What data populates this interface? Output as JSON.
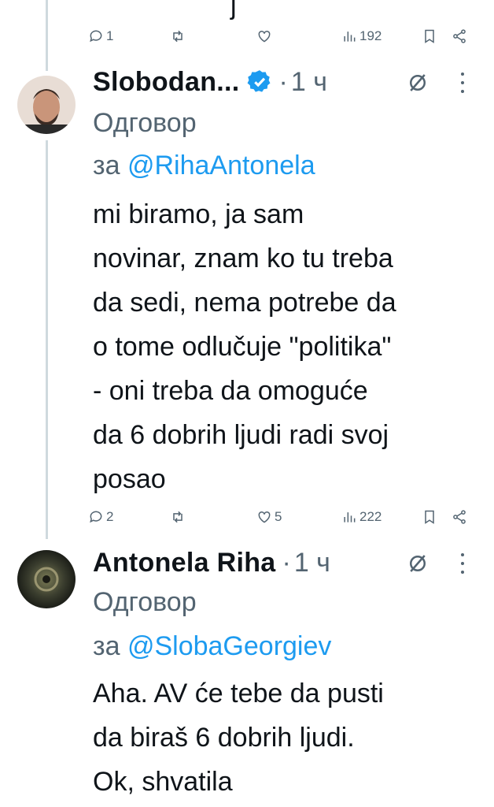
{
  "top_tweet": {
    "fragment": "ј",
    "actions": {
      "replies": "1",
      "reposts": "",
      "likes": "",
      "views": "192"
    }
  },
  "tweet1": {
    "author": "Slobodan...",
    "verified": true,
    "separator": "·",
    "time": "1 ч",
    "reply_label": "Одговор",
    "reply_prefix": "за",
    "reply_handle": "@RihaAntonela",
    "text": "mi biramo, ja sam\nnovinar, znam ko tu treba\nda sedi, nema potrebe da\no tome odlučuje \"politika\"\n- oni treba da omoguće\nda 6 dobrih ljudi radi svoj\nposao",
    "actions": {
      "replies": "2",
      "reposts": "",
      "likes": "5",
      "views": "222"
    }
  },
  "tweet2": {
    "author": "Antonela Riha",
    "separator": "·",
    "time": "1 ч",
    "reply_label": "Одговор",
    "reply_prefix": "за",
    "reply_handle": "@SlobaGeorgiev",
    "text": "Aha. AV će tebe da pusti\nda biraš 6 dobrih ljudi.\nOk, shvatila"
  },
  "colors": {
    "accent": "#1d9bf0",
    "muted": "#536471",
    "text": "#0f1419",
    "thread_line": "#cfd9de"
  }
}
